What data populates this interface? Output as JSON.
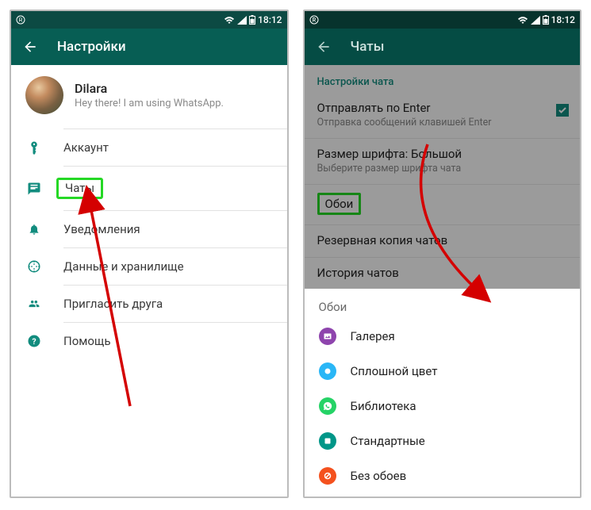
{
  "status": {
    "time": "18:12"
  },
  "left": {
    "header_title": "Настройки",
    "profile": {
      "name": "Dilara",
      "status": "Hey there! I am using WhatsApp."
    },
    "menu": {
      "account": "Аккаунт",
      "chats": "Чаты",
      "notifications": "Уведомления",
      "data": "Данные и хранилище",
      "invite": "Пригласить друга",
      "help": "Помощь"
    }
  },
  "right": {
    "header_title": "Чаты",
    "section_label": "Настройки чата",
    "enter": {
      "primary": "Отправлять по Enter",
      "secondary": "Отправка сообщений клавишей Enter"
    },
    "font": {
      "primary": "Размер шрифта: Большой",
      "secondary": "Выберите размер шрифта чата"
    },
    "wallpaper": "Обои",
    "backup": "Резервная копия чатов",
    "history": "История чатов",
    "sheet": {
      "title": "Обои",
      "gallery": "Галерея",
      "solid": "Сплошной цвет",
      "library": "Библиотека",
      "default": "Стандартные",
      "none": "Без обоев"
    }
  }
}
